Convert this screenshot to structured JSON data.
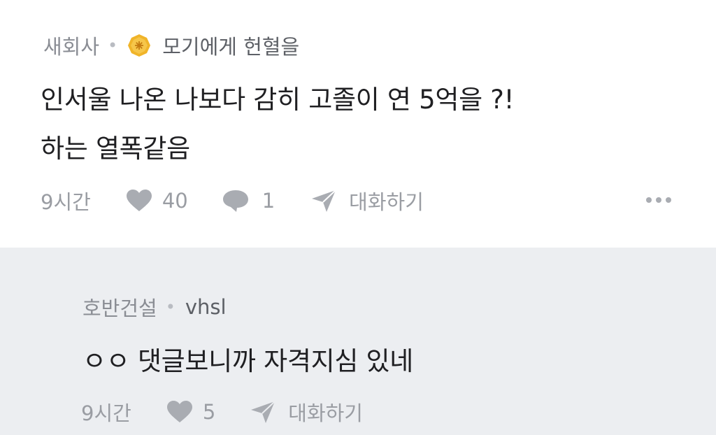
{
  "post": {
    "company": "새회사",
    "author": "모기에게 헌혈을",
    "lines": [
      "인서울 나온 나보다 감히 고졸이 연 5억을 ?!",
      "하는 열폭같음"
    ],
    "time": "9시간",
    "likes": "40",
    "comments": "1",
    "chat_label": "대화하기"
  },
  "reply": {
    "company": "호반건설",
    "author": "vhsl",
    "text": "ㅇㅇ 댓글보니까 자격지심 있네",
    "time": "9시간",
    "likes": "5",
    "chat_label": "대화하기"
  },
  "icons": {
    "badge": "gold-badge-icon",
    "heart": "heart-icon",
    "comment": "comment-bubble-icon",
    "send": "paper-plane-icon",
    "more": "more-dots-icon"
  },
  "colors": {
    "reply_background": "#eceef1",
    "badge": "#f0b429"
  }
}
